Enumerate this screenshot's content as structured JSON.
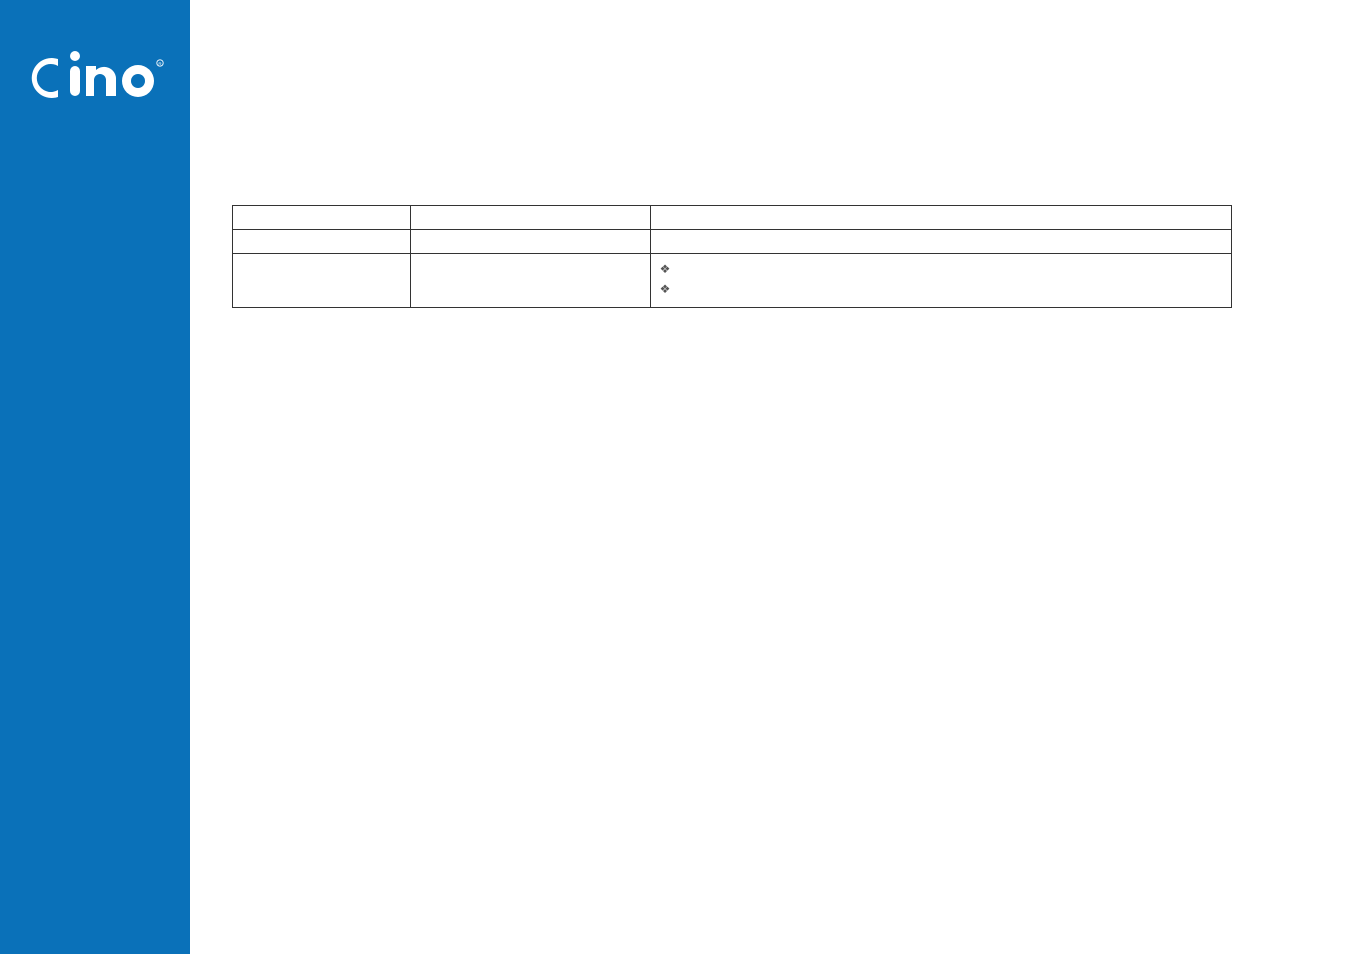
{
  "brand": {
    "name": "cino",
    "color": "#0a71b9"
  },
  "table": {
    "rows": [
      {
        "c1": "",
        "c2": "",
        "c3": ""
      },
      {
        "c1": "",
        "c2": "",
        "c3": ""
      }
    ],
    "bullet_row": {
      "c1": "",
      "c2": "",
      "items": [
        "",
        ""
      ]
    }
  }
}
